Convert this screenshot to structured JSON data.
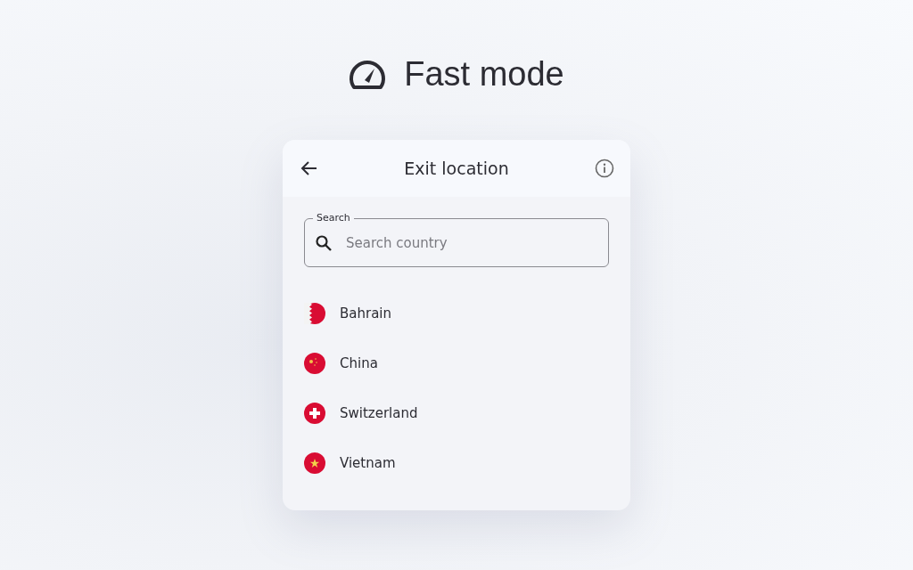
{
  "heading": {
    "title": "Fast mode"
  },
  "panel": {
    "title": "Exit location"
  },
  "search": {
    "label": "Search",
    "placeholder": "Search country"
  },
  "countries": [
    {
      "name": "Bahrain",
      "kind": "bahrain"
    },
    {
      "name": "China",
      "kind": "china"
    },
    {
      "name": "Switzerland",
      "kind": "swiss"
    },
    {
      "name": "Vietnam",
      "kind": "vietnam"
    }
  ]
}
